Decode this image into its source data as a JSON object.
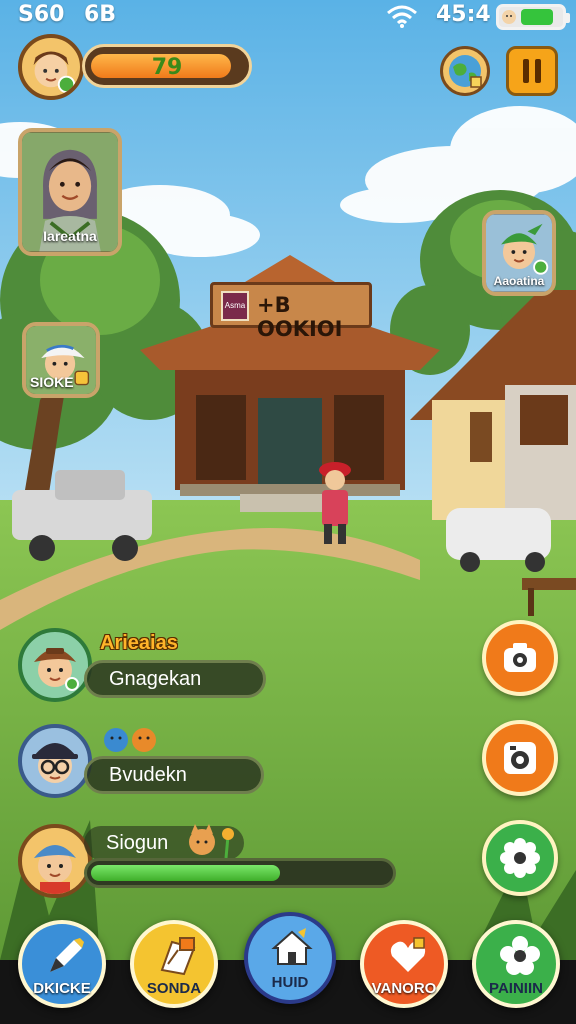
{
  "status_bar": {
    "left_text": "S60",
    "left_text_2": "6B",
    "time": "45:4",
    "battery_level": 0.8
  },
  "player": {
    "level_text": "79",
    "xp_fraction": 0.92
  },
  "portraits": {
    "top_left": "Iareatna",
    "right": "Aaoatina",
    "left_small": "SIOKE"
  },
  "building_sign": {
    "logo_text": "Asma",
    "text": "+B OOKIOI"
  },
  "friends": [
    {
      "title": "Arieaias",
      "text": "Gnagekan"
    },
    {
      "title": "",
      "text": "Bvudekn"
    },
    {
      "title": "",
      "text": "Siogun",
      "progress": 0.63
    }
  ],
  "side_buttons": [
    {
      "icon": "camera-icon",
      "color": "#f07a1a"
    },
    {
      "icon": "photo-icon",
      "color": "#f07a1a"
    },
    {
      "icon": "gear-icon",
      "color": "#3bb04a"
    }
  ],
  "bottom_nav": [
    {
      "label": "DKICKE",
      "icon": "pencil-icon",
      "color": "#3a8fd8"
    },
    {
      "label": "SONDA",
      "icon": "map-icon",
      "color": "#f4c430"
    },
    {
      "label": "HUID",
      "icon": "home-icon",
      "color": "#5aa8e8"
    },
    {
      "label": "VANORO",
      "icon": "heart-icon",
      "color": "#ee5a24"
    },
    {
      "label": "PAINIIN",
      "icon": "flower-icon",
      "color": "#3bb04a"
    }
  ]
}
